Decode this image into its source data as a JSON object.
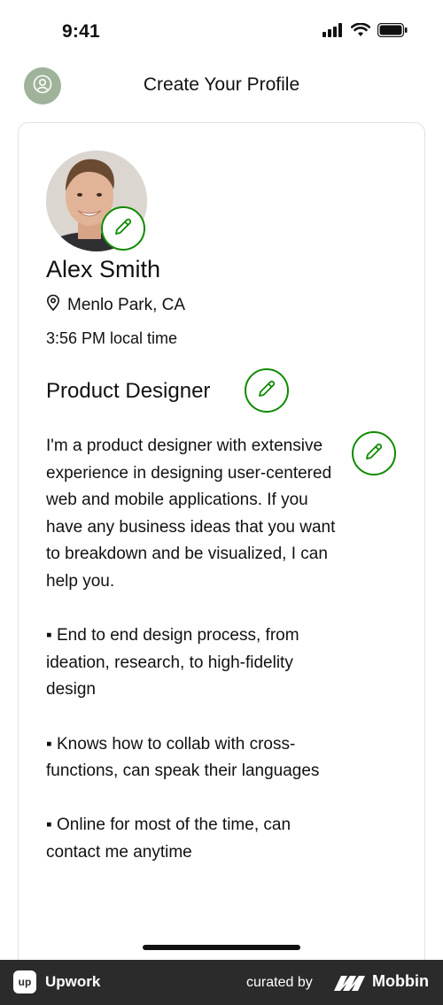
{
  "status_bar": {
    "time": "9:41",
    "icons": [
      "cellular-signal-icon",
      "wifi-icon",
      "battery-icon"
    ]
  },
  "header": {
    "title": "Create Your Profile",
    "avatar_icon": "user-circle-icon"
  },
  "profile": {
    "name": "Alex Smith",
    "location": "Menlo Park, CA",
    "location_icon": "location-pin-icon",
    "local_time": "3:56 PM local time",
    "job_title": "Product Designer",
    "bio": [
      "I'm a product designer with extensive experience in designing user-centered web and mobile applications. If you have any business ideas that you want to breakdown and be visualized, I can help you.",
      "▪ End to end design process, from ideation, research, to high-fidelity design",
      "▪ Knows how to collab with cross-functions, can speak their languages",
      "▪ Online for most of the time, can contact me anytime"
    ],
    "edit_icon": "pencil-icon"
  },
  "footer": {
    "app_logo_text": "up",
    "app_name": "Upwork",
    "curated_by": "curated by",
    "brand": "Mobbin"
  },
  "colors": {
    "accent_green": "#108a00",
    "header_avatar_bg": "#9fb39a",
    "footer_bg": "#2b2b2b",
    "card_border": "#e2e2e2"
  }
}
